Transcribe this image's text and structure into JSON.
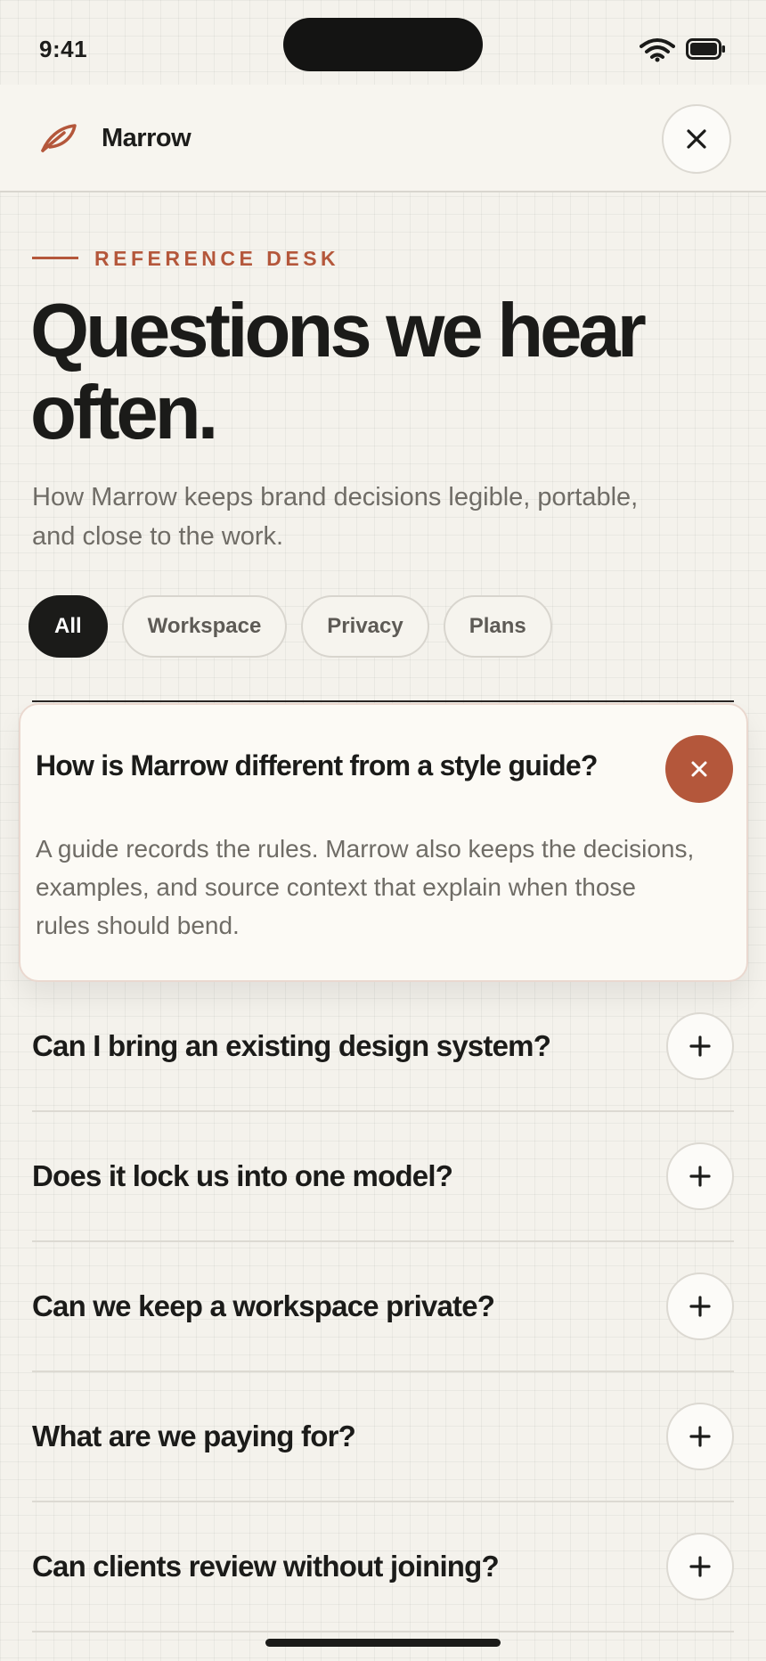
{
  "status_bar": {
    "time": "9:41"
  },
  "app": {
    "name": "Marrow"
  },
  "colors": {
    "accent": "#b4573b",
    "ink": "#1b1b19",
    "muted": "#6f6c66",
    "paper": "#f4f2ec"
  },
  "hero": {
    "eyebrow": "REFERENCE DESK",
    "title": "Questions we hear often.",
    "subtitle": "How Marrow keeps brand decisions legible, portable, and close to the work."
  },
  "filters": [
    {
      "label": "All",
      "selected": true
    },
    {
      "label": "Workspace",
      "selected": false
    },
    {
      "label": "Privacy",
      "selected": false
    },
    {
      "label": "Plans",
      "selected": false
    }
  ],
  "faq": {
    "expanded": {
      "question": "How is Marrow different from a style guide?",
      "answer": "A guide records the rules. Marrow also keeps the decisions, examples, and source context that explain when those rules should bend."
    },
    "items": [
      {
        "question": "Can I bring an existing design system?"
      },
      {
        "question": "Does it lock us into one model?"
      },
      {
        "question": "Can we keep a workspace private?"
      },
      {
        "question": "What are we paying for?"
      },
      {
        "question": "Can clients review without joining?"
      }
    ]
  },
  "icons": {
    "logo": "feather-icon",
    "close": "close-icon",
    "collapse": "close-icon",
    "expand": "plus-icon",
    "wifi": "wifi-icon",
    "battery": "battery-icon"
  }
}
